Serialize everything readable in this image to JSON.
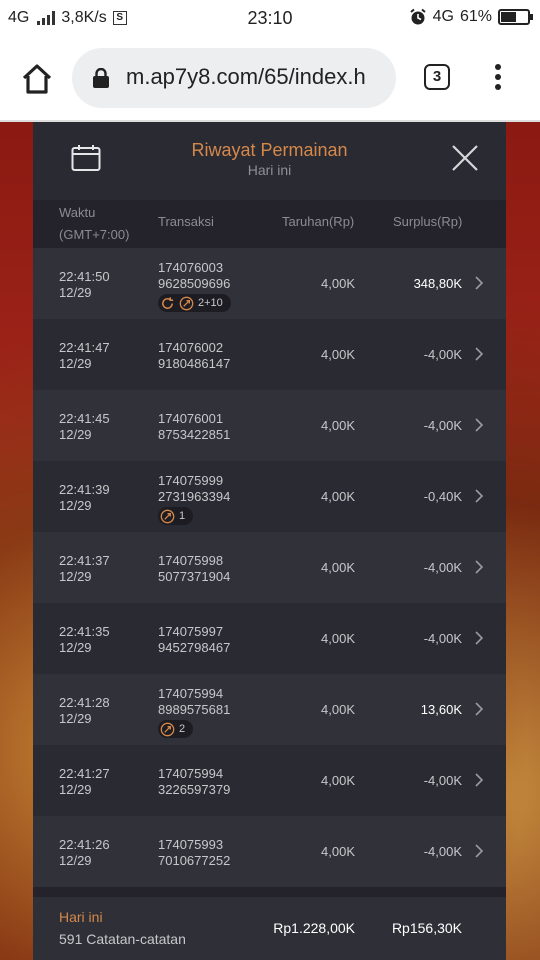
{
  "statusbar": {
    "network": "4G",
    "speed": "3,8K/s",
    "s_badge": "S",
    "time": "23:10",
    "network_right": "4G",
    "battery_percent": "61%",
    "battery_level": 0.61
  },
  "browser": {
    "url": "m.ap7y8.com/65/index.h",
    "tab_count": "3"
  },
  "panel": {
    "title": "Riwayat Permainan",
    "subtitle": "Hari ini",
    "columns": {
      "time": "Waktu",
      "timezone": "(GMT+7:00)",
      "transaction": "Transaksi",
      "bet": "Taruhan(Rp)",
      "surplus": "Surplus(Rp)"
    },
    "rows": [
      {
        "time": "22:41:50",
        "date": "12/29",
        "id1": "174076003",
        "id2": "9628509696",
        "badges": [
          {
            "icons": [
              "refresh-icon",
              "free-spin-icon"
            ],
            "text": "2+10"
          }
        ],
        "bet": "4,00K",
        "surplus": "348,80K"
      },
      {
        "time": "22:41:47",
        "date": "12/29",
        "id1": "174076002",
        "id2": "9180486147",
        "badges": [],
        "bet": "4,00K",
        "surplus": "-4,00K"
      },
      {
        "time": "22:41:45",
        "date": "12/29",
        "id1": "174076001",
        "id2": "8753422851",
        "badges": [],
        "bet": "4,00K",
        "surplus": "-4,00K"
      },
      {
        "time": "22:41:39",
        "date": "12/29",
        "id1": "174075999",
        "id2": "2731963394",
        "badges": [
          {
            "icons": [
              "free-spin-icon"
            ],
            "text": "1"
          }
        ],
        "bet": "4,00K",
        "surplus": "-0,40K"
      },
      {
        "time": "22:41:37",
        "date": "12/29",
        "id1": "174075998",
        "id2": "5077371904",
        "badges": [],
        "bet": "4,00K",
        "surplus": "-4,00K"
      },
      {
        "time": "22:41:35",
        "date": "12/29",
        "id1": "174075997",
        "id2": "9452798467",
        "badges": [],
        "bet": "4,00K",
        "surplus": "-4,00K"
      },
      {
        "time": "22:41:28",
        "date": "12/29",
        "id1": "174075994",
        "id2": "8989575681",
        "badges": [
          {
            "icons": [
              "free-spin-icon"
            ],
            "text": "2"
          }
        ],
        "bet": "4,00K",
        "surplus": "13,60K"
      },
      {
        "time": "22:41:27",
        "date": "12/29",
        "id1": "174075994",
        "id2": "3226597379",
        "badges": [],
        "bet": "4,00K",
        "surplus": "-4,00K"
      },
      {
        "time": "22:41:26",
        "date": "12/29",
        "id1": "174075993",
        "id2": "7010677252",
        "badges": [],
        "bet": "4,00K",
        "surplus": "-4,00K"
      }
    ],
    "footer": {
      "label": "Hari ini",
      "count": "591 Catatan-catatan",
      "total_bet": "Rp1.228,00K",
      "total_surplus": "Rp156,30K"
    }
  },
  "colors": {
    "accent": "#d4884a",
    "panel_bg": "#24232b",
    "row_dark": "#31313a",
    "row_light": "#2a2a32"
  }
}
